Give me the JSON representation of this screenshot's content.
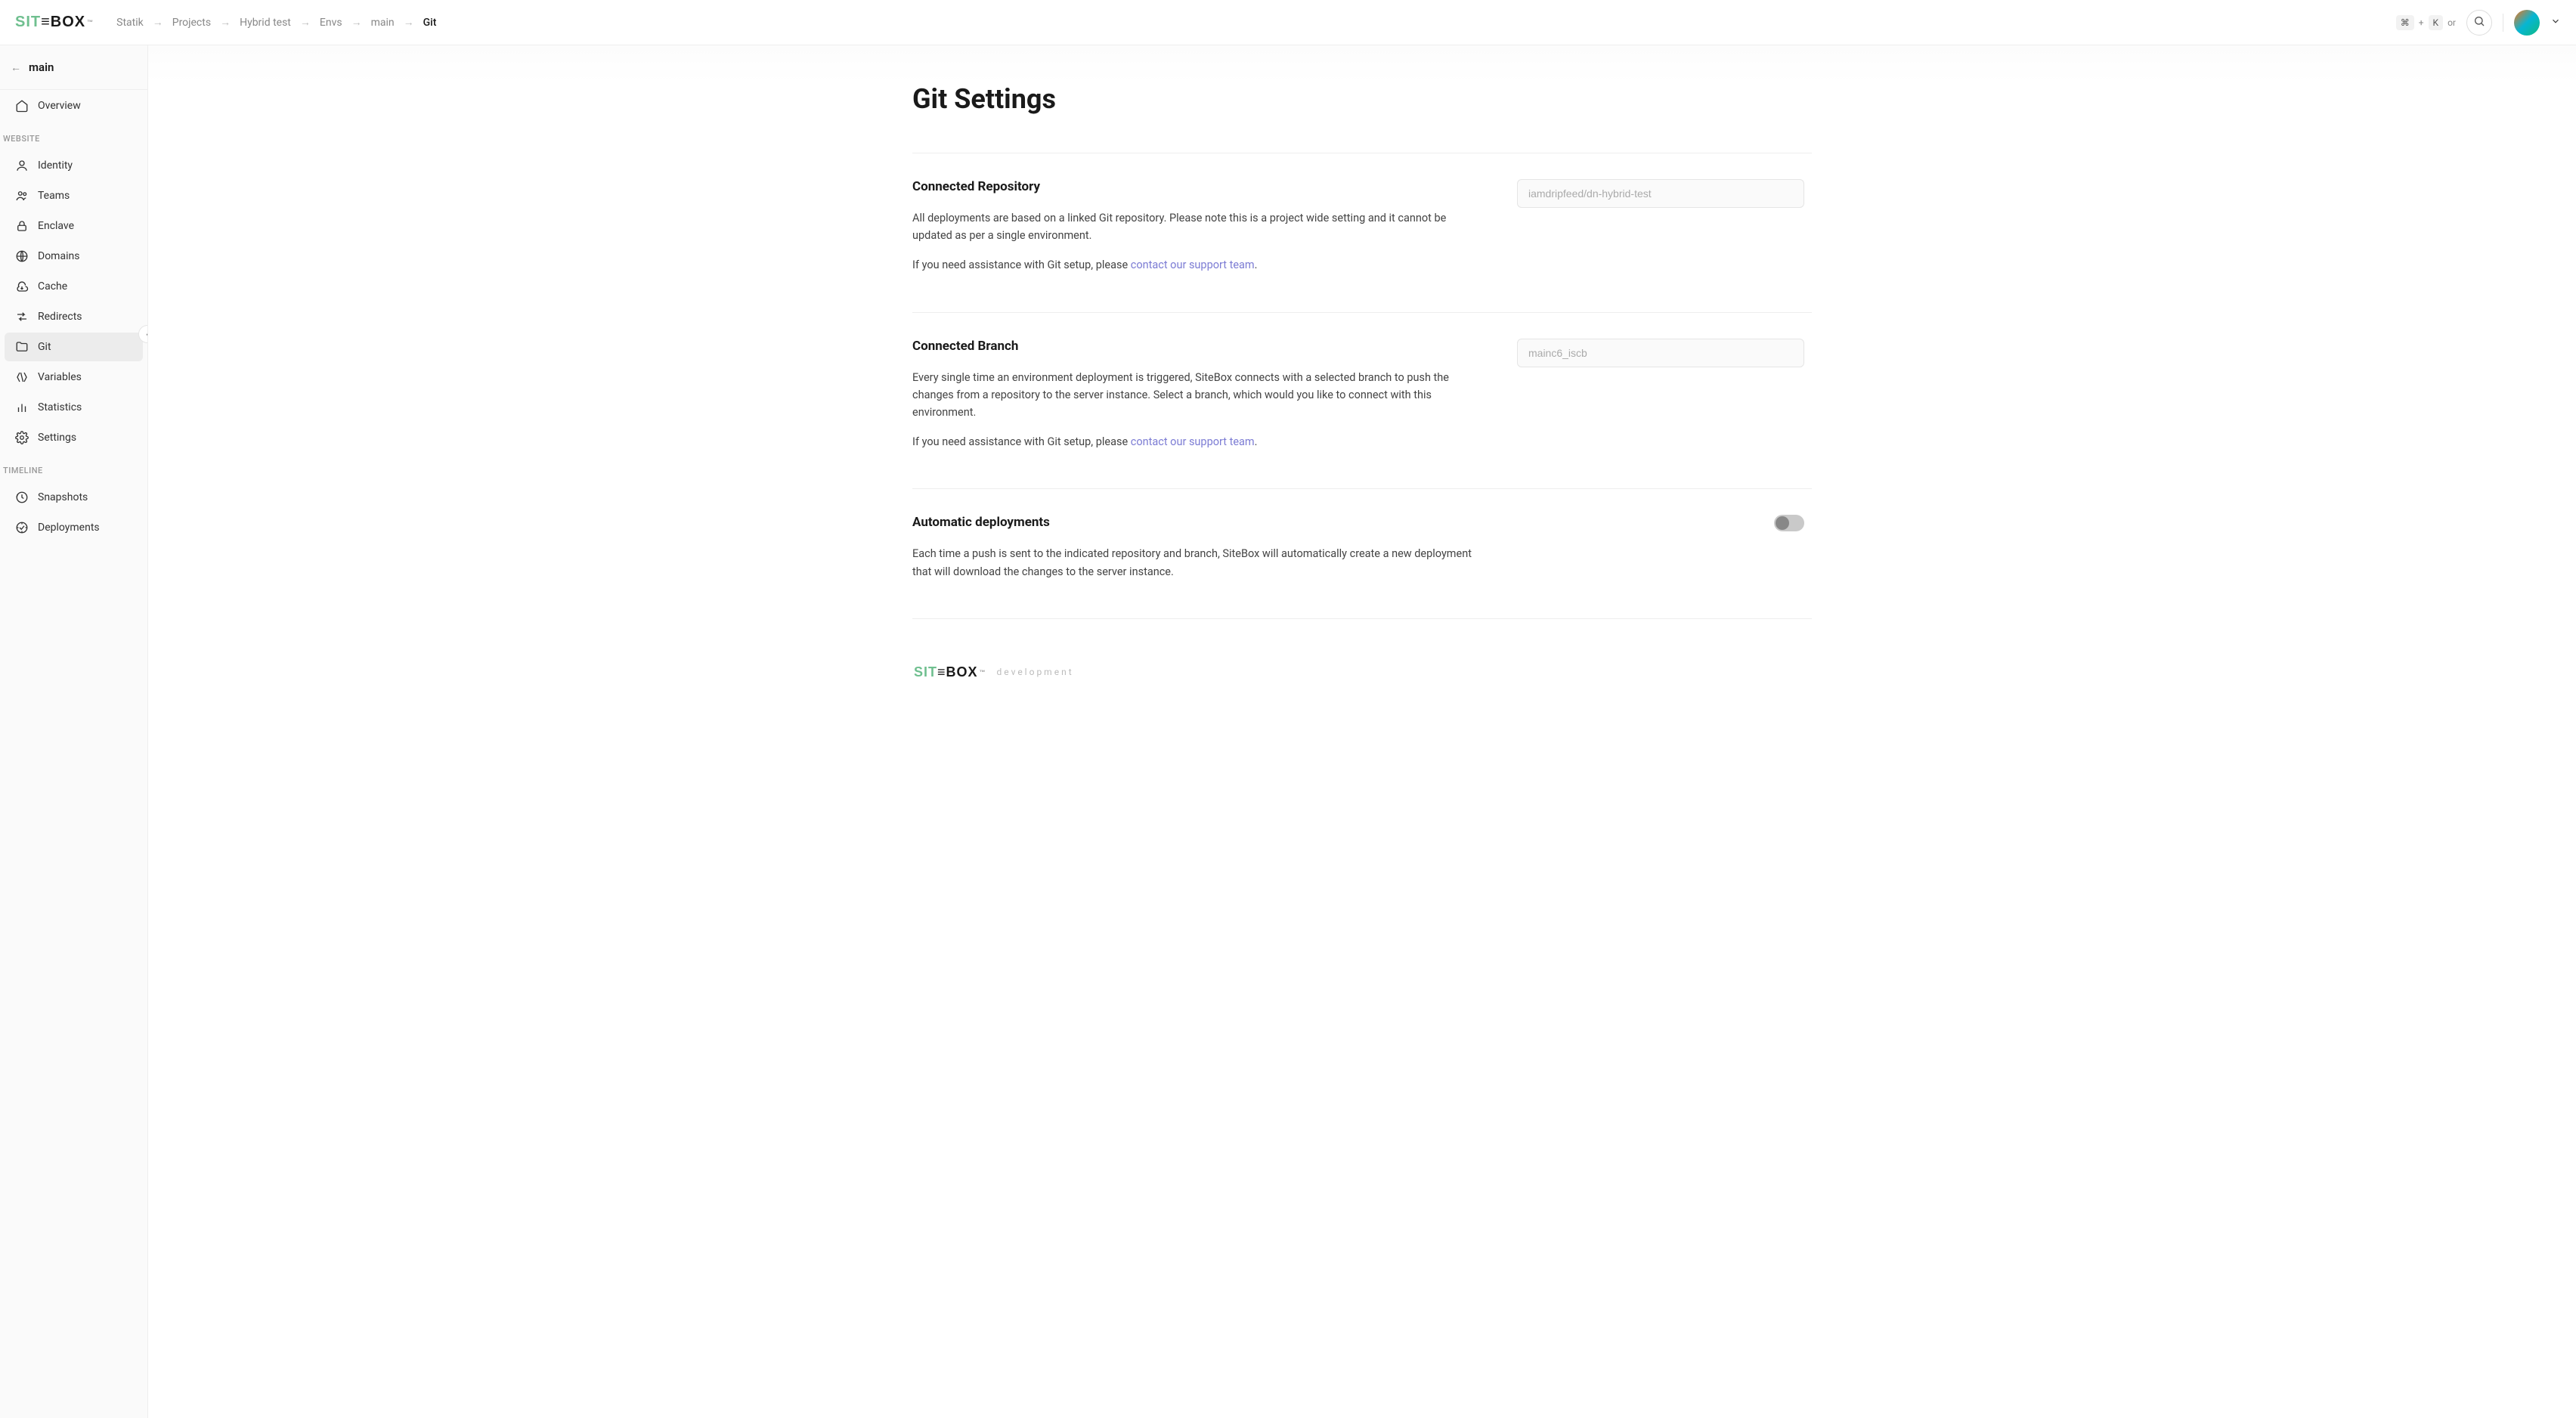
{
  "logo": {
    "part1": "SIT",
    "part2": "≡BOX",
    "tm": "™"
  },
  "breadcrumb": [
    "Statik",
    "Projects",
    "Hybrid test",
    "Envs",
    "main",
    "Git"
  ],
  "breadcrumb_active_index": 5,
  "kbd": {
    "cmd": "⌘",
    "plus": "+",
    "k": "K",
    "or": "or"
  },
  "sidebar": {
    "env": "main",
    "overview": "Overview",
    "section_website": "WEBSITE",
    "items_website": [
      "Identity",
      "Teams",
      "Enclave",
      "Domains",
      "Cache",
      "Redirects",
      "Git",
      "Variables",
      "Statistics",
      "Settings"
    ],
    "active_website_index": 6,
    "section_timeline": "TIMELINE",
    "items_timeline": [
      "Snapshots",
      "Deployments"
    ]
  },
  "page": {
    "title": "Git Settings"
  },
  "sections": {
    "repo": {
      "title": "Connected Repository",
      "desc": "All deployments are based on a linked Git repository. Please note this is a project wide setting and it cannot be updated as per a single environment.",
      "help_prefix": "If you need assistance with Git setup, please ",
      "help_link": "contact our support team",
      "help_suffix": ".",
      "value": "iamdripfeed/dn-hybrid-test"
    },
    "branch": {
      "title": "Connected Branch",
      "desc": "Every single time an environment deployment is triggered, SiteBox connects with a selected branch to push the changes from a repository to the server instance. Select a branch, which would you like to connect with this environment.",
      "help_prefix": "If you need assistance with Git setup, please ",
      "help_link": "contact our support team",
      "help_suffix": ".",
      "value": "mainc6_iscb"
    },
    "auto": {
      "title": "Automatic deployments",
      "desc": "Each time a push is sent to the indicated repository and branch, SiteBox will automatically create a new deployment that will download the changes to the server instance."
    }
  },
  "footer": {
    "label": "development"
  }
}
